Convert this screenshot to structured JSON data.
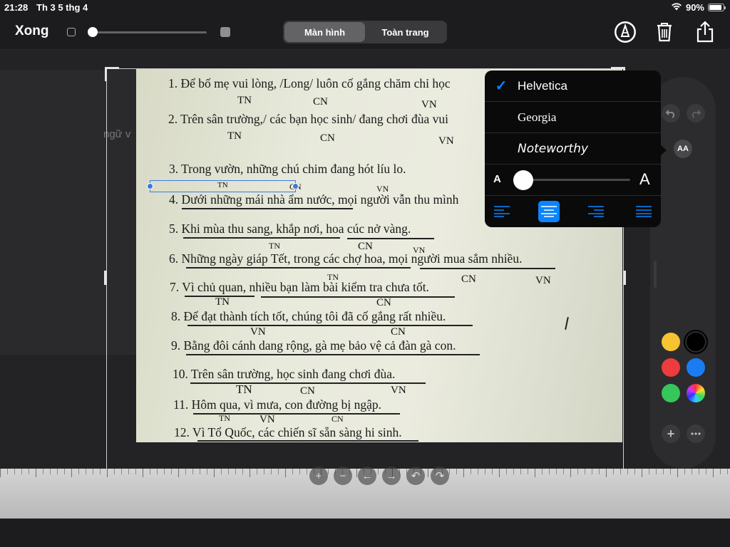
{
  "status": {
    "time": "21:28",
    "date": "Th 3 5 thg 4",
    "battery": "90%"
  },
  "toolbar": {
    "done_label": "Xong",
    "seg_screen": "Màn hình",
    "seg_full": "Toàn trang"
  },
  "doc": {
    "sidebar_fragment": "ngữ v",
    "lines": [
      "1.  Để bố mẹ vui lòng, /Long/ luôn cố gắng chăm chỉ học",
      "2.  Trên sân trường,/ các bạn học sinh/ đang chơi đùa vui",
      "3. Trong vườn, những chú chim đang hót líu lo.",
      "4. Dưới những mái nhà ẩm nước, mọi người vẫn thu mình",
      "5. Khi mùa thu sang, khắp nơi, hoa cúc nở vàng.",
      "6. Những ngày giáp Tết, trong các chợ hoa, mọi người mua sắm nhiều.",
      "7. Vì chủ quan, nhiều bạn làm bài kiểm tra chưa tốt.",
      "8.  Để đạt thành tích tốt, chúng tôi đã cố gắng rất nhiều.",
      "9. Bằng đôi cánh dang rộng, gà mẹ bảo vệ cả đàn gà con.",
      "10. Trên sân trường, học sinh đang chơi đùa.",
      "11. Hôm qua, vì mưa, con đường bị ngập.",
      "12.  Vì Tổ Quốc, các chiến sĩ sẵn sàng hi sinh."
    ],
    "labels": {
      "tn": "TN",
      "cn": "CN",
      "vn": "VN",
      "tn_small": "TN",
      "cn_small": "CN",
      "vn_small": "VN"
    },
    "selected_text": "TN"
  },
  "fonts": {
    "options": [
      "Helvetica",
      "Georgia",
      "Noteworthy"
    ],
    "selected": "Helvetica",
    "size_small": "A",
    "size_large": "A",
    "size_level": 0.08
  },
  "palette": {
    "aa_label": "AA",
    "colors": [
      "#f6c431",
      "#000000",
      "#ee3b3d",
      "#1a7cf3",
      "#35c759",
      "#rainbow"
    ]
  },
  "colors": {
    "accent": "#0a84ff",
    "selection": "#3d7bd9"
  }
}
